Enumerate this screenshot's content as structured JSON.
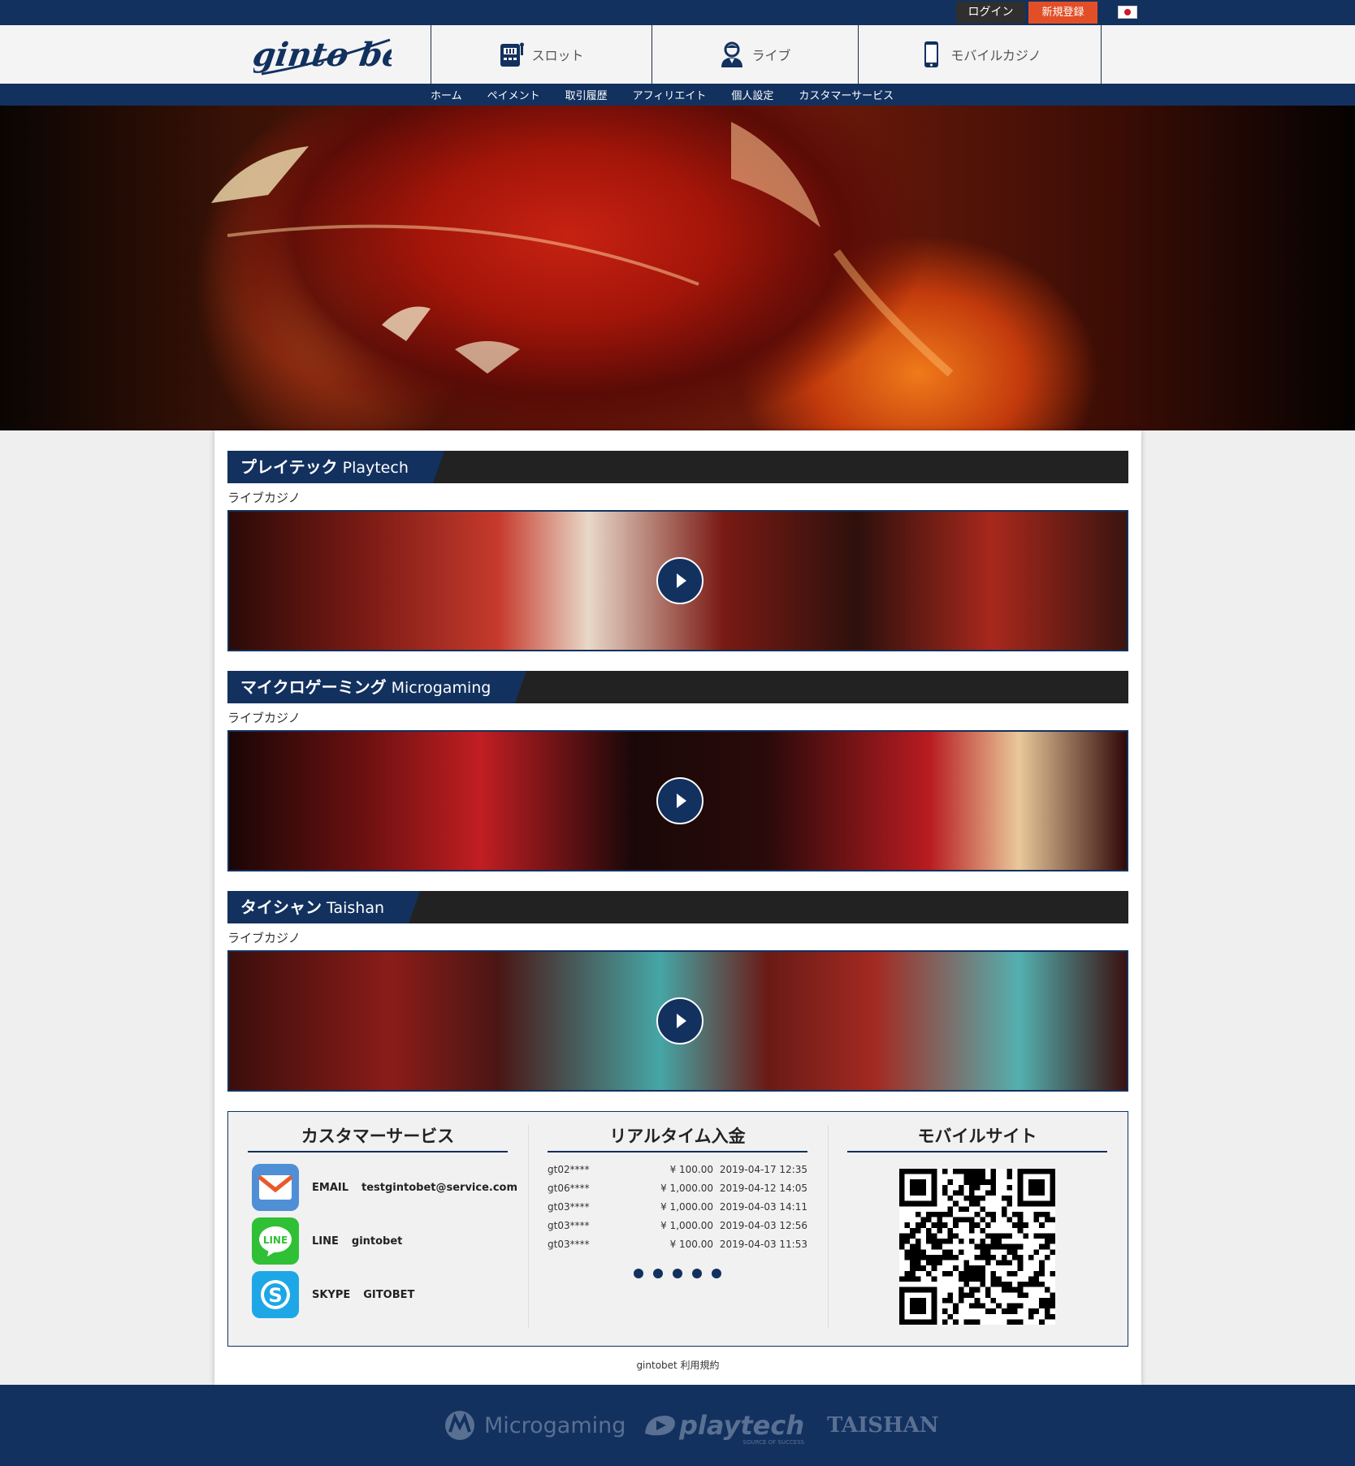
{
  "topbar": {
    "login_label": "ログイン",
    "register_label": "新規登録"
  },
  "header": {
    "logo_text": "ginto bet",
    "nav": [
      {
        "label": "スロット",
        "icon": "slot-machine-icon"
      },
      {
        "label": "ライブ",
        "icon": "live-dealer-icon"
      },
      {
        "label": "モバイルカジノ",
        "icon": "smartphone-icon"
      }
    ]
  },
  "subnav": {
    "items": [
      "ホーム",
      "ペイメント",
      "取引履歴",
      "アフィリエイト",
      "個人設定",
      "カスタマーサービス"
    ]
  },
  "sections": [
    {
      "title_jp": "プレイテック",
      "title_en": "Playtech",
      "subtitle": "ライブカジノ"
    },
    {
      "title_jp": "マイクロゲーミング",
      "title_en": "Microgaming",
      "subtitle": "ライブカジノ"
    },
    {
      "title_jp": "タイシャン",
      "title_en": "Taishan",
      "subtitle": "ライブカジノ"
    }
  ],
  "customer_service": {
    "title": "カスタマーサービス",
    "contacts": [
      {
        "label": "EMAIL",
        "value": "testgintobet@service.com",
        "icon": "email-icon"
      },
      {
        "label": "LINE",
        "value": "gintobet",
        "icon": "line-icon"
      },
      {
        "label": "SKYPE",
        "value": "GITOBET",
        "icon": "skype-icon"
      }
    ]
  },
  "deposits": {
    "title": "リアルタイム入金",
    "rows": [
      {
        "user": "gt02****",
        "amount": "¥ 100.00",
        "time": "2019-04-17 12:35"
      },
      {
        "user": "gt06****",
        "amount": "¥ 1,000.00",
        "time": "2019-04-12 14:05"
      },
      {
        "user": "gt03****",
        "amount": "¥ 1,000.00",
        "time": "2019-04-03 14:11"
      },
      {
        "user": "gt03****",
        "amount": "¥ 1,000.00",
        "time": "2019-04-03 12:56"
      },
      {
        "user": "gt03****",
        "amount": "¥ 100.00",
        "time": "2019-04-03 11:53"
      }
    ]
  },
  "mobile": {
    "title": "モバイルサイト"
  },
  "terms_label": "gintobet 利用規約",
  "providers": {
    "microgaming": "Microgaming",
    "playtech": "playtech",
    "playtech_tag": "SOURCE OF SUCCESS",
    "taishan": "TAISHAN"
  },
  "colors": {
    "navy": "#12315f",
    "register": "#e24f27",
    "section_bar": "#222222"
  }
}
